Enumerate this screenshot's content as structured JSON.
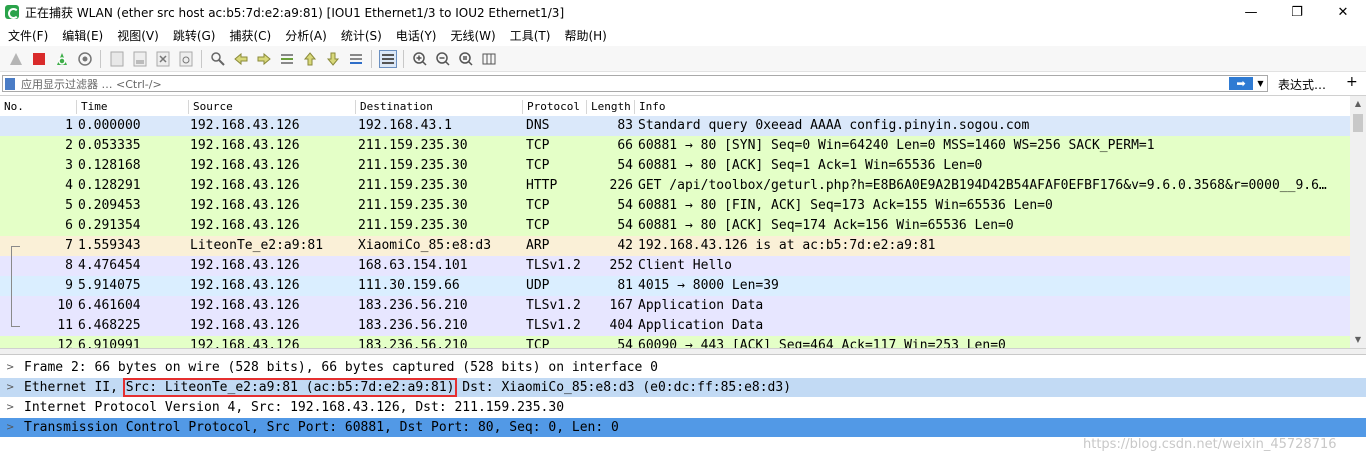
{
  "window": {
    "title": "正在捕获 WLAN (ether src host ac:b5:7d:e2:a9:81) [IOU1 Ethernet1/3 to IOU2 Ethernet1/3]",
    "minimize": "—",
    "maximize": "❐",
    "close": "✕"
  },
  "menu": [
    "文件(F)",
    "编辑(E)",
    "视图(V)",
    "跳转(G)",
    "捕获(C)",
    "分析(A)",
    "统计(S)",
    "电话(Y)",
    "无线(W)",
    "工具(T)",
    "帮助(H)"
  ],
  "filter": {
    "placeholder": "应用显示过滤器 … <Ctrl-/>",
    "apply_icon": "arrow-right-icon",
    "expression_label": "表达式…",
    "add_label": "+"
  },
  "columns": [
    "No.",
    "Time",
    "Source",
    "Destination",
    "Protocol",
    "Length",
    "Info"
  ],
  "colors": {
    "dns": "#dae8fa",
    "tcp": "#e4ffc7",
    "arp": "#faf0d7",
    "tls": "#e7e6ff",
    "udp": "#daeeff",
    "selected": "#5299e6",
    "details_hl": "#c2daf4"
  },
  "packets": [
    {
      "no": "1",
      "time": "0.000000",
      "src": "192.168.43.126",
      "dst": "192.168.43.1",
      "proto": "DNS",
      "len": "83",
      "info": "Standard query 0xeead AAAA config.pinyin.sogou.com",
      "color": "#dae8fa"
    },
    {
      "no": "2",
      "time": "0.053335",
      "src": "192.168.43.126",
      "dst": "211.159.235.30",
      "proto": "TCP",
      "len": "66",
      "info": "60881 → 80 [SYN] Seq=0 Win=64240 Len=0 MSS=1460 WS=256 SACK_PERM=1",
      "color": "#e4ffc7"
    },
    {
      "no": "3",
      "time": "0.128168",
      "src": "192.168.43.126",
      "dst": "211.159.235.30",
      "proto": "TCP",
      "len": "54",
      "info": "60881 → 80 [ACK] Seq=1 Ack=1 Win=65536 Len=0",
      "color": "#e4ffc7"
    },
    {
      "no": "4",
      "time": "0.128291",
      "src": "192.168.43.126",
      "dst": "211.159.235.30",
      "proto": "HTTP",
      "len": "226",
      "info": "GET /api/toolbox/geturl.php?h=E8B6A0E9A2B194D42B54AFAF0EFBF176&v=9.6.0.3568&r=0000__9.6…",
      "color": "#e4ffc7"
    },
    {
      "no": "5",
      "time": "0.209453",
      "src": "192.168.43.126",
      "dst": "211.159.235.30",
      "proto": "TCP",
      "len": "54",
      "info": "60881 → 80 [FIN, ACK] Seq=173 Ack=155 Win=65536 Len=0",
      "color": "#e4ffc7"
    },
    {
      "no": "6",
      "time": "0.291354",
      "src": "192.168.43.126",
      "dst": "211.159.235.30",
      "proto": "TCP",
      "len": "54",
      "info": "60881 → 80 [ACK] Seq=174 Ack=156 Win=65536 Len=0",
      "color": "#e4ffc7"
    },
    {
      "no": "7",
      "time": "1.559343",
      "src": "LiteonTe_e2:a9:81",
      "dst": "XiaomiCo_85:e8:d3",
      "proto": "ARP",
      "len": "42",
      "info": "192.168.43.126 is at ac:b5:7d:e2:a9:81",
      "color": "#faf0d7"
    },
    {
      "no": "8",
      "time": "4.476454",
      "src": "192.168.43.126",
      "dst": "168.63.154.101",
      "proto": "TLSv1.2",
      "len": "252",
      "info": "Client Hello",
      "color": "#e7e6ff"
    },
    {
      "no": "9",
      "time": "5.914075",
      "src": "192.168.43.126",
      "dst": "111.30.159.66",
      "proto": "UDP",
      "len": "81",
      "info": "4015 → 8000 Len=39",
      "color": "#daeeff"
    },
    {
      "no": "10",
      "time": "6.461604",
      "src": "192.168.43.126",
      "dst": "183.236.56.210",
      "proto": "TLSv1.2",
      "len": "167",
      "info": "Application Data",
      "color": "#e7e6ff"
    },
    {
      "no": "11",
      "time": "6.468225",
      "src": "192.168.43.126",
      "dst": "183.236.56.210",
      "proto": "TLSv1.2",
      "len": "404",
      "info": "Application Data",
      "color": "#e7e6ff"
    },
    {
      "no": "12",
      "time": "6.910991",
      "src": "192.168.43.126",
      "dst": "183.236.56.210",
      "proto": "TCP",
      "len": "54",
      "info": "60090 → 443 [ACK] Seq=464 Ack=117 Win=253 Len=0",
      "color": "#e4ffc7"
    }
  ],
  "details": [
    {
      "text": "Frame 2: 66 bytes on wire (528 bits), 66 bytes captured (528 bits) on interface 0"
    },
    {
      "pre": "Ethernet II, ",
      "boxed": "Src: LiteonTe_e2:a9:81 (ac:b5:7d:e2:a9:81)",
      "post": " Dst: XiaomiCo_85:e8:d3 (e0:dc:ff:85:e8:d3)"
    },
    {
      "text": "Internet Protocol Version 4, Src: 192.168.43.126, Dst: 211.159.235.30"
    },
    {
      "text": "Transmission Control Protocol, Src Port: 60881, Dst Port: 80, Seq: 0, Len: 0"
    }
  ],
  "watermark": "https://blog.csdn.net/weixin_45728716"
}
